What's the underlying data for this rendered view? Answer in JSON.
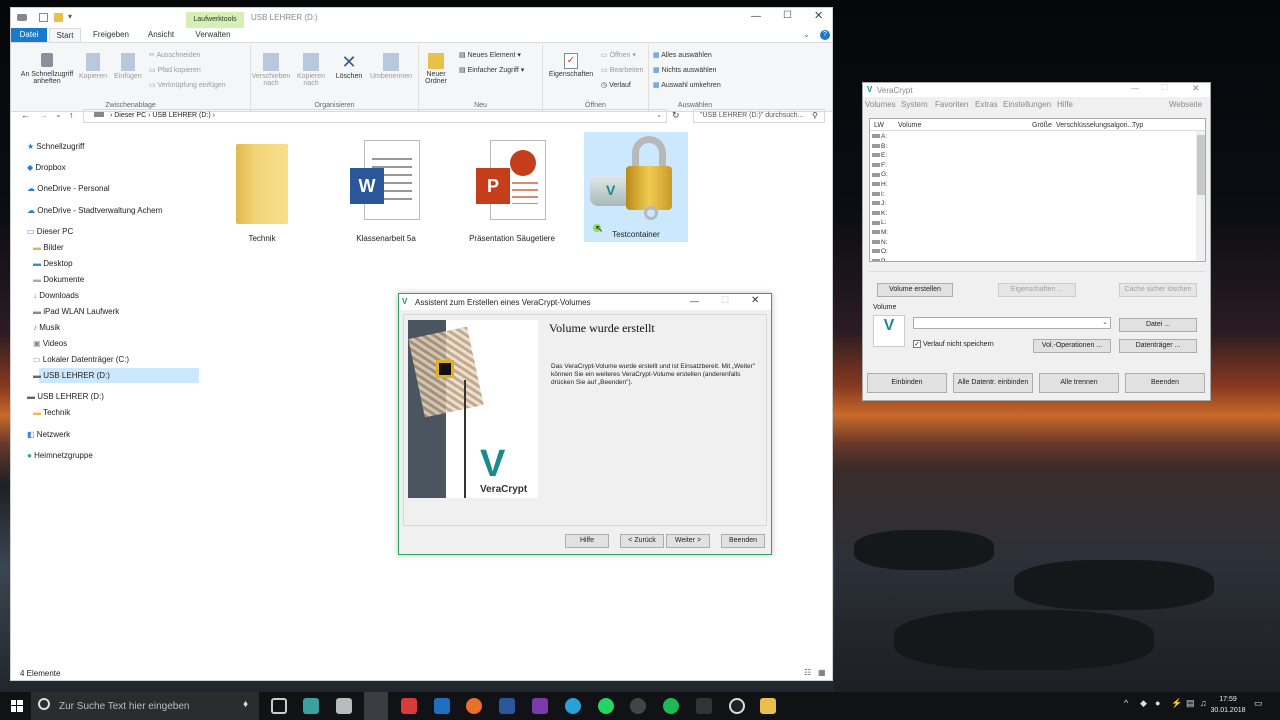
{
  "explorer": {
    "window_title": "USB LEHRER (D:)",
    "context_tab": "Laufwerktools",
    "tabs": [
      "Datei",
      "Start",
      "Freigeben",
      "Ansicht",
      "Verwalten"
    ],
    "ribbon": {
      "clipboard": {
        "pin": "An Schnellzugriff anheften",
        "copy": "Kopieren",
        "paste": "Einfügen",
        "cut": "Ausschneiden",
        "copy_path": "Pfad kopieren",
        "paste_shortcut": "Verknüpfung einfügen",
        "label": "Zwischenablage"
      },
      "organize": {
        "move_to": "Verschieben nach",
        "copy_to": "Kopieren nach",
        "delete": "Löschen",
        "rename": "Umbenennen",
        "label": "Organisieren"
      },
      "new": {
        "new_folder": "Neuer Ordner",
        "new_item": "Neues Element",
        "easy_access": "Einfacher Zugriff",
        "label": "Neu"
      },
      "open": {
        "properties": "Eigenschaften",
        "open": "Öffnen",
        "edit": "Bearbeiten",
        "history": "Verlauf",
        "label": "Öffnen"
      },
      "select": {
        "select_all": "Alles auswählen",
        "select_none": "Nichts auswählen",
        "invert": "Auswahl umkehren",
        "label": "Auswählen"
      }
    },
    "address": {
      "crumbs": [
        "Dieser PC",
        "USB LEHRER (D:)"
      ],
      "search_placeholder": "\"USB LEHRER (D:)\" durchsuch..."
    },
    "nav": {
      "quick_access": "Schnellzugriff",
      "dropbox": "Dropbox",
      "onedrive_personal": "OneDrive - Personal",
      "onedrive_work": "OneDrive - Stadtverwaltung Achern",
      "this_pc": "Dieser PC",
      "pictures": "Bilder",
      "desktop": "Desktop",
      "documents": "Dokumente",
      "downloads": "Downloads",
      "ipad": "iPad WLAN Laufwerk",
      "music": "Musik",
      "videos": "Videos",
      "local_disk": "Lokaler Datenträger (C:)",
      "usb_sel": "USB LEHRER (D:)",
      "usb": "USB LEHRER (D:)",
      "technik": "Technik",
      "network": "Netzwerk",
      "homegroup": "Heimnetzgruppe"
    },
    "files": [
      "Technik",
      "Klassenarbeit 5a",
      "Präsentation Säugetiere",
      "Testcontainer"
    ],
    "status": "4 Elemente"
  },
  "veracrypt": {
    "title": "VeraCrypt",
    "menu": [
      "Volumes",
      "System",
      "Favoriten",
      "Extras",
      "Einstellungen",
      "Hilfe"
    ],
    "website": "Webseite",
    "columns": [
      "LW",
      "Volume",
      "Größe",
      "Verschlüsselungsalgori...",
      "Typ"
    ],
    "drives": [
      "A:",
      "B:",
      "E:",
      "F:",
      "G:",
      "H:",
      "I:",
      "J:",
      "K:",
      "L:",
      "M:",
      "N:",
      "O:",
      "P:"
    ],
    "create_volume": "Volume erstellen",
    "properties": "Eigenschaften ...",
    "wipe_cache": "Cache sicher löschen",
    "volume_label": "Volume",
    "file_btn": "Datei ...",
    "history_label": "Verlauf nicht speichern",
    "vol_ops": "Vol.-Operationen ...",
    "device_btn": "Datenträger ...",
    "mount": "Einbinden",
    "automount": "Alle Datentr. einbinden",
    "dismount_all": "Alle trennen",
    "exit": "Beenden"
  },
  "wizard": {
    "title": "Assistent zum Erstellen eines VeraCrypt-Volumes",
    "heading": "Volume wurde erstellt",
    "body": "Das VeraCrypt-Volume wurde erstellt und ist Einsatzbereit. Mit „Weiter\" können Sie ein weiteres VeraCrypt-Volume erstellen (anderenfalls drücken Sie auf „Beenden\").",
    "logo_text": "VeraCrypt",
    "help": "Hilfe",
    "back": "< Zurück",
    "next": "Weiter >",
    "finish": "Beenden"
  },
  "taskbar": {
    "search_placeholder": "Zur Suche Text hier eingeben",
    "time": "17:59",
    "date": "30.01.2018"
  },
  "colors": {
    "accent": "#1979ca",
    "ribbon_context": "#d4f0b4",
    "selection": "#cce8ff",
    "wizard_border": "#2fa360"
  }
}
